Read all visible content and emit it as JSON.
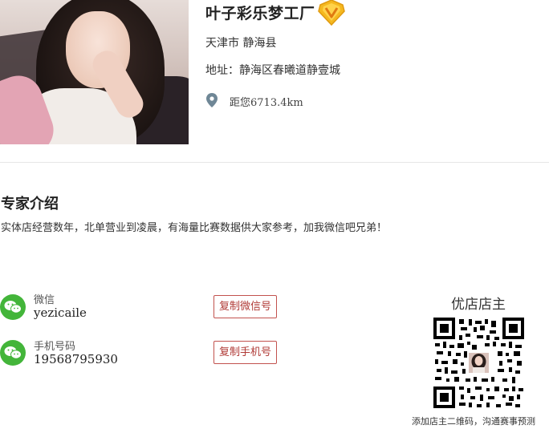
{
  "store": {
    "name": "叶子彩乐梦工厂",
    "badge_icon": "v-verified-badge-icon",
    "location": "天津市 静海县",
    "address": "地址：静海区春曦道静壹城",
    "distance": "距您6713.4km"
  },
  "expert": {
    "heading": "专家介绍",
    "intro": "实体店经营数年，北单营业到凌晨，有海量比赛数据供大家参考，加我微信吧兄弟！"
  },
  "contacts": [
    {
      "icon": "wechat-icon",
      "label": "微信",
      "value": "yezicaile",
      "button": "复制微信号"
    },
    {
      "icon": "wechat-icon",
      "label": "手机号码",
      "value": "19568795930",
      "button": "复制手机号"
    }
  ],
  "owner": {
    "title": "优店店主",
    "caption": "添加店主二维码，沟通赛事预测"
  },
  "colors": {
    "wechat_green": "#43b53a",
    "button_red": "#b03a36",
    "badge_gold": "#f5b81f"
  }
}
